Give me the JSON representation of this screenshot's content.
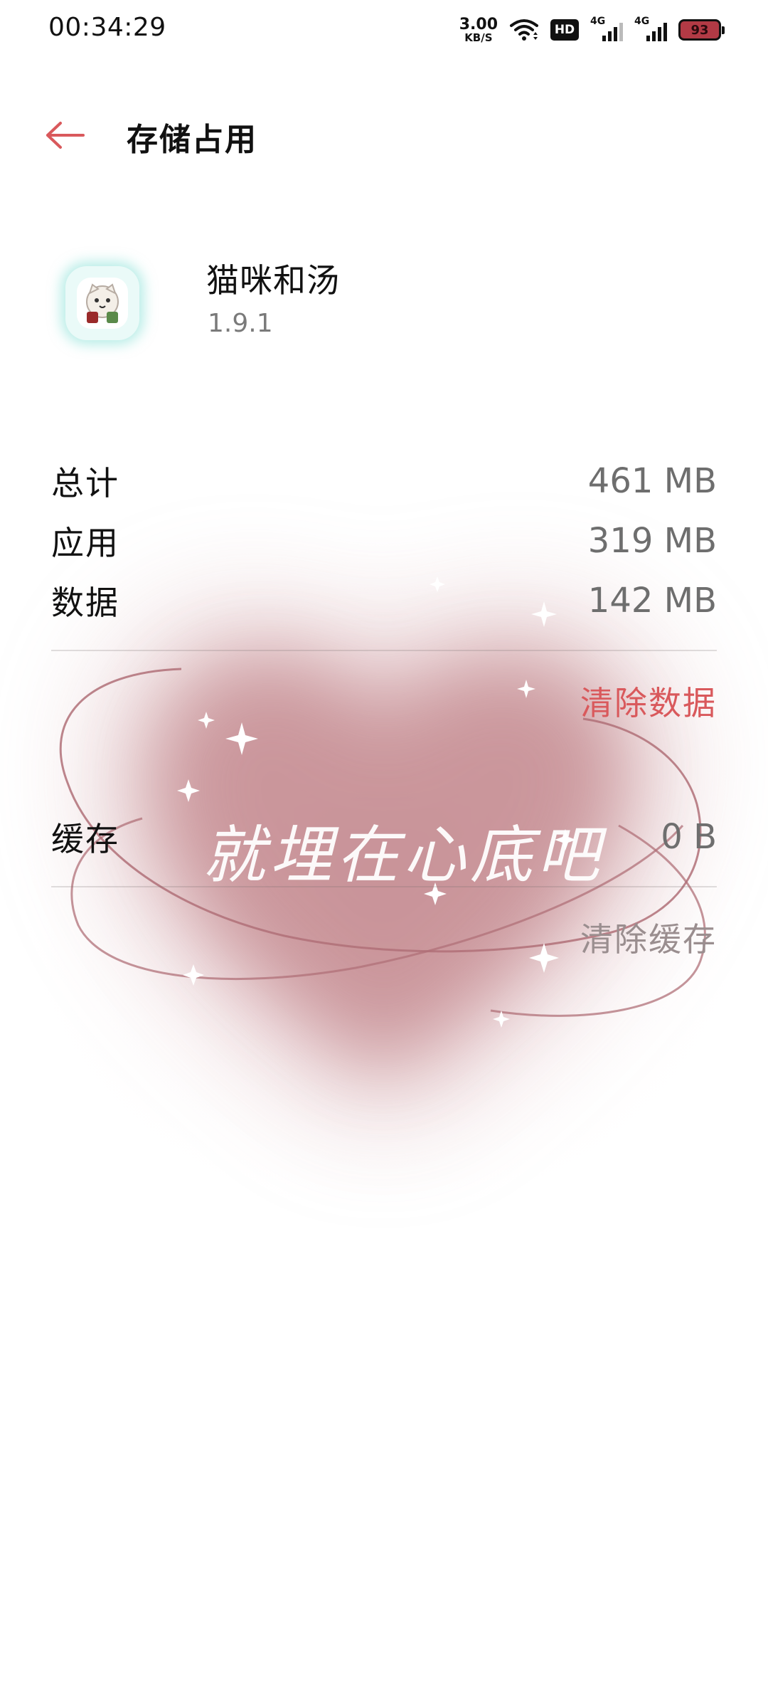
{
  "status_bar": {
    "time": "00:34:29",
    "net_speed_value": "3.00",
    "net_speed_unit": "KB/S",
    "hd_label": "HD",
    "sim1_tag": "4G",
    "sim2_tag": "4G",
    "battery_level": "93"
  },
  "header": {
    "title": "存储占用"
  },
  "app": {
    "name": "猫咪和汤",
    "version": "1.9.1"
  },
  "storage": {
    "total_label": "总计",
    "total_value": "461 MB",
    "app_label": "应用",
    "app_value": "319 MB",
    "data_label": "数据",
    "data_value": "142 MB",
    "clear_data_label": "清除数据",
    "cache_label": "缓存",
    "cache_value": "0 B",
    "clear_cache_label": "清除缓存"
  },
  "wallpaper": {
    "caption": "就埋在心底吧"
  },
  "colors": {
    "accent": "#d9595c",
    "heart": "#c58c92",
    "app_icon_glow": "#78dcd2"
  }
}
